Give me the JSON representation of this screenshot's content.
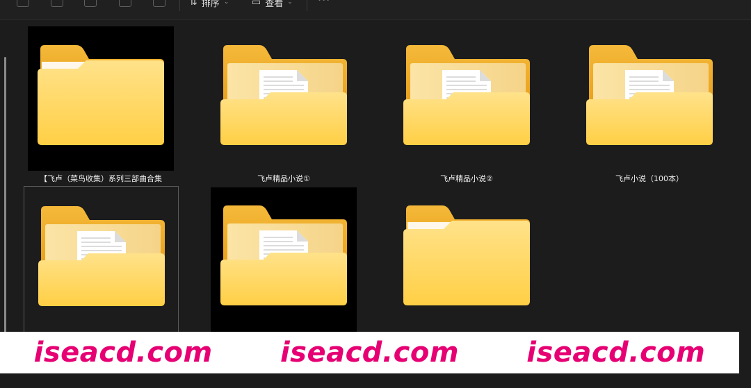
{
  "toolbar": {
    "icons": [
      "copy-icon",
      "paste-icon",
      "rename-icon",
      "share-icon",
      "delete-icon"
    ],
    "sort_label": "排序",
    "view_label": "查看",
    "more_label": "···"
  },
  "files": [
    {
      "name": "【飞卢（菜鸟收集）系列三部曲合集",
      "type": "empty-folder",
      "dark_thumb": true,
      "selected": false
    },
    {
      "name": "飞卢精品小说①",
      "type": "document-folder",
      "dark_thumb": false,
      "selected": false
    },
    {
      "name": "飞卢精品小说②",
      "type": "document-folder",
      "dark_thumb": false,
      "selected": false
    },
    {
      "name": "飞卢小说（100本）",
      "type": "document-folder",
      "dark_thumb": false,
      "selected": false
    },
    {
      "name": "",
      "type": "document-folder",
      "dark_thumb": false,
      "selected": true
    },
    {
      "name": "",
      "type": "document-folder",
      "dark_thumb": true,
      "selected": false
    },
    {
      "name": "",
      "type": "empty-folder",
      "dark_thumb": false,
      "selected": false
    }
  ],
  "watermark": {
    "text": [
      "iseacd.com",
      "iseacd.com",
      "iseacd.com"
    ],
    "color": "#e60073"
  },
  "colors": {
    "background": "#1c1c1c",
    "folder_back": "#f2b430",
    "folder_front": "#ffd45a"
  }
}
